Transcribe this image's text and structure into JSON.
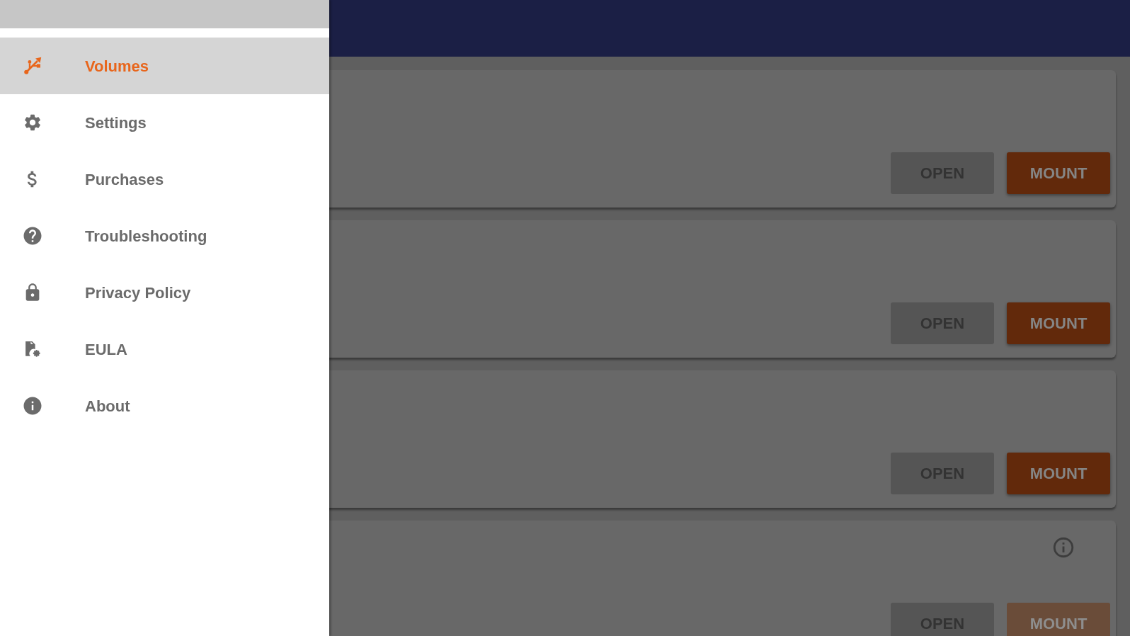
{
  "drawer": {
    "items": [
      {
        "label": "Volumes",
        "selected": true
      },
      {
        "label": "Settings",
        "selected": false
      },
      {
        "label": "Purchases",
        "selected": false
      },
      {
        "label": "Troubleshooting",
        "selected": false
      },
      {
        "label": "Privacy Policy",
        "selected": false
      },
      {
        "label": "EULA",
        "selected": false
      },
      {
        "label": "About",
        "selected": false
      }
    ]
  },
  "volumes": [
    {
      "info": false,
      "buttons": [
        {
          "kind": "flat",
          "label": "OPEN",
          "disabled": true
        },
        {
          "kind": "raised",
          "label": "MOUNT",
          "disabled": false
        }
      ]
    },
    {
      "info": false,
      "buttons": [
        {
          "kind": "flat",
          "label": "OPEN",
          "disabled": true
        },
        {
          "kind": "raised",
          "label": "MOUNT",
          "disabled": false
        }
      ]
    },
    {
      "info": false,
      "buttons": [
        {
          "kind": "flat",
          "label": "OPEN",
          "disabled": true
        },
        {
          "kind": "raised",
          "label": "MOUNT",
          "disabled": false
        }
      ]
    },
    {
      "info": true,
      "buttons": [
        {
          "kind": "flat",
          "label": "OPEN",
          "disabled": true
        },
        {
          "kind": "raised",
          "label": "MOUNT",
          "disabled": true
        }
      ]
    }
  ]
}
